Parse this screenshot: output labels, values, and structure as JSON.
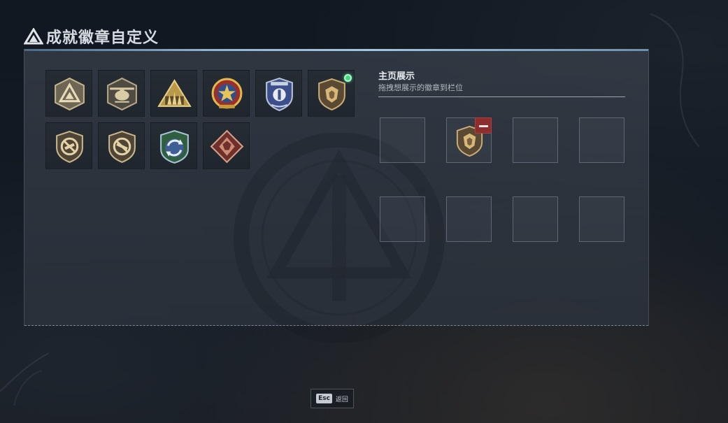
{
  "page": {
    "title": "成就徽章自定义"
  },
  "badge_collection": {
    "badges": [
      {
        "icon": "delta-triangle-badge-icon",
        "equipped": false
      },
      {
        "icon": "helicopter-badge-icon",
        "equipped": false
      },
      {
        "icon": "squad-triangle-badge-icon",
        "equipped": false
      },
      {
        "icon": "star-medal-badge-icon",
        "equipped": false
      },
      {
        "icon": "blue-shield-badge-icon",
        "equipped": false
      },
      {
        "icon": "lion-shield-badge-icon",
        "equipped": true
      },
      {
        "icon": "no-gun-shield-badge-icon",
        "equipped": false
      },
      {
        "icon": "no-gun-shield-badge-icon-2",
        "equipped": false
      },
      {
        "icon": "rotating-arrows-badge-icon",
        "equipped": false
      },
      {
        "icon": "dragon-diamond-badge-icon",
        "equipped": false
      }
    ]
  },
  "homepage_display": {
    "title": "主页展示",
    "subtitle": "拖拽想展示的徽章到栏位",
    "slots": [
      {
        "badge": null
      },
      {
        "badge": "lion-shield-badge-icon",
        "removable": true
      },
      {
        "badge": null
      },
      {
        "badge": null
      },
      {
        "badge": null
      },
      {
        "badge": null
      },
      {
        "badge": null
      },
      {
        "badge": null
      }
    ]
  },
  "footer": {
    "esc_key": "Esc",
    "esc_label": "返回"
  },
  "colors": {
    "equipped_indicator": "#3be07d",
    "remove_button": "#8e2d2d",
    "panel_accent": "#8fb4d2"
  }
}
